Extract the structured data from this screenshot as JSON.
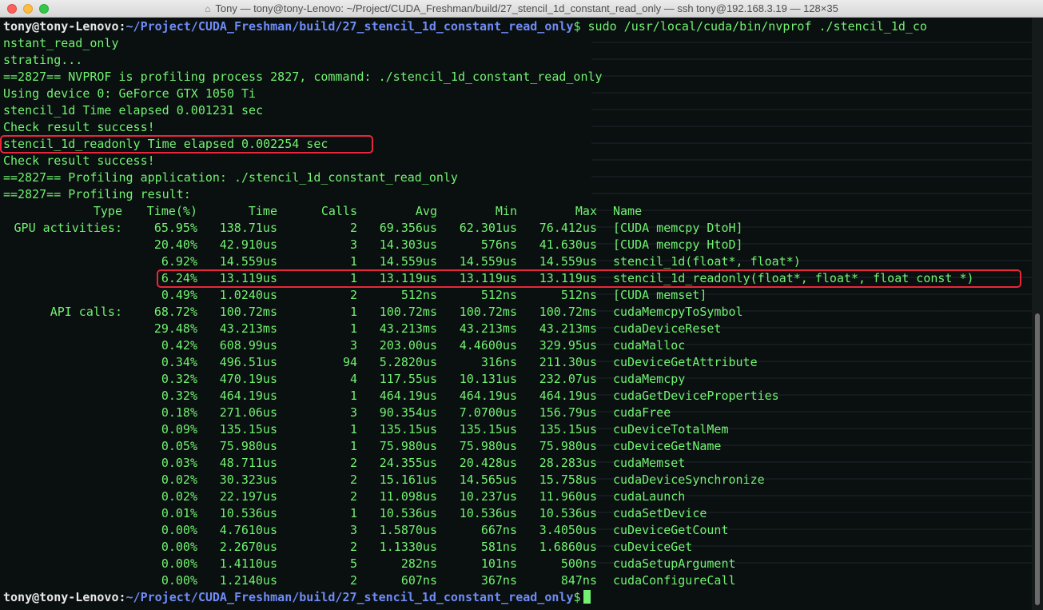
{
  "window": {
    "title": "Tony — tony@tony-Lenovo: ~/Project/CUDA_Freshman/build/27_stencil_1d_constant_read_only — ssh tony@192.168.3.19 — 128×35",
    "title_icon": "home-icon"
  },
  "colors": {
    "green": "#72f272",
    "blue": "#6f8cf6",
    "highlight": "#e8283a"
  },
  "terminal": {
    "prompt_user": "tony@tony-Lenovo:",
    "prompt_path": "~/Project/CUDA_Freshman/build/27_stencil_1d_constant_read_only",
    "prompt_symbol": "$",
    "command_line": " sudo /usr/local/cuda/bin/nvprof ./stencil_1d_co",
    "command_wrap": "nstant_read_only",
    "output": [
      "strating...",
      "==2827== NVPROF is profiling process 2827, command: ./stencil_1d_constant_read_only",
      "Using device 0: GeForce GTX 1050 Ti",
      "stencil_1d Time elapsed 0.001231 sec",
      "Check result success!",
      "stencil_1d_readonly Time elapsed 0.002254 sec",
      "Check result success!",
      "==2827== Profiling application: ./stencil_1d_constant_read_only",
      "==2827== Profiling result:"
    ],
    "table": {
      "headers": [
        "Type",
        "Time(%)",
        "Time",
        "Calls",
        "Avg",
        "Min",
        "Max",
        "Name"
      ],
      "rows": [
        [
          "GPU activities:",
          "65.95%",
          "138.71us",
          "2",
          "69.356us",
          "62.301us",
          "76.412us",
          "[CUDA memcpy DtoH]"
        ],
        [
          "",
          "20.40%",
          "42.910us",
          "3",
          "14.303us",
          "576ns",
          "41.630us",
          "[CUDA memcpy HtoD]"
        ],
        [
          "",
          "6.92%",
          "14.559us",
          "1",
          "14.559us",
          "14.559us",
          "14.559us",
          "stencil_1d(float*, float*)"
        ],
        [
          "",
          "6.24%",
          "13.119us",
          "1",
          "13.119us",
          "13.119us",
          "13.119us",
          "stencil_1d_readonly(float*, float*, float const *)"
        ],
        [
          "",
          "0.49%",
          "1.0240us",
          "2",
          "512ns",
          "512ns",
          "512ns",
          "[CUDA memset]"
        ],
        [
          "API calls:",
          "68.72%",
          "100.72ms",
          "1",
          "100.72ms",
          "100.72ms",
          "100.72ms",
          "cudaMemcpyToSymbol"
        ],
        [
          "",
          "29.48%",
          "43.213ms",
          "1",
          "43.213ms",
          "43.213ms",
          "43.213ms",
          "cudaDeviceReset"
        ],
        [
          "",
          "0.42%",
          "608.99us",
          "3",
          "203.00us",
          "4.4600us",
          "329.95us",
          "cudaMalloc"
        ],
        [
          "",
          "0.34%",
          "496.51us",
          "94",
          "5.2820us",
          "316ns",
          "211.30us",
          "cuDeviceGetAttribute"
        ],
        [
          "",
          "0.32%",
          "470.19us",
          "4",
          "117.55us",
          "10.131us",
          "232.07us",
          "cudaMemcpy"
        ],
        [
          "",
          "0.32%",
          "464.19us",
          "1",
          "464.19us",
          "464.19us",
          "464.19us",
          "cudaGetDeviceProperties"
        ],
        [
          "",
          "0.18%",
          "271.06us",
          "3",
          "90.354us",
          "7.0700us",
          "156.79us",
          "cudaFree"
        ],
        [
          "",
          "0.09%",
          "135.15us",
          "1",
          "135.15us",
          "135.15us",
          "135.15us",
          "cuDeviceTotalMem"
        ],
        [
          "",
          "0.05%",
          "75.980us",
          "1",
          "75.980us",
          "75.980us",
          "75.980us",
          "cuDeviceGetName"
        ],
        [
          "",
          "0.03%",
          "48.711us",
          "2",
          "24.355us",
          "20.428us",
          "28.283us",
          "cudaMemset"
        ],
        [
          "",
          "0.02%",
          "30.323us",
          "2",
          "15.161us",
          "14.565us",
          "15.758us",
          "cudaDeviceSynchronize"
        ],
        [
          "",
          "0.02%",
          "22.197us",
          "2",
          "11.098us",
          "10.237us",
          "11.960us",
          "cudaLaunch"
        ],
        [
          "",
          "0.01%",
          "10.536us",
          "1",
          "10.536us",
          "10.536us",
          "10.536us",
          "cudaSetDevice"
        ],
        [
          "",
          "0.00%",
          "4.7610us",
          "3",
          "1.5870us",
          "667ns",
          "3.4050us",
          "cuDeviceGetCount"
        ],
        [
          "",
          "0.00%",
          "2.2670us",
          "2",
          "1.1330us",
          "581ns",
          "1.6860us",
          "cuDeviceGet"
        ],
        [
          "",
          "0.00%",
          "1.4110us",
          "5",
          "282ns",
          "101ns",
          "500ns",
          "cudaSetupArgument"
        ],
        [
          "",
          "0.00%",
          "1.2140us",
          "2",
          "607ns",
          "367ns",
          "847ns",
          "cudaConfigureCall"
        ]
      ]
    },
    "highlighted_output_line": "stencil_1d_readonly Time elapsed 0.002254 sec",
    "highlighted_table_row": "stencil_1d_readonly(float*, float*, float const *)"
  }
}
